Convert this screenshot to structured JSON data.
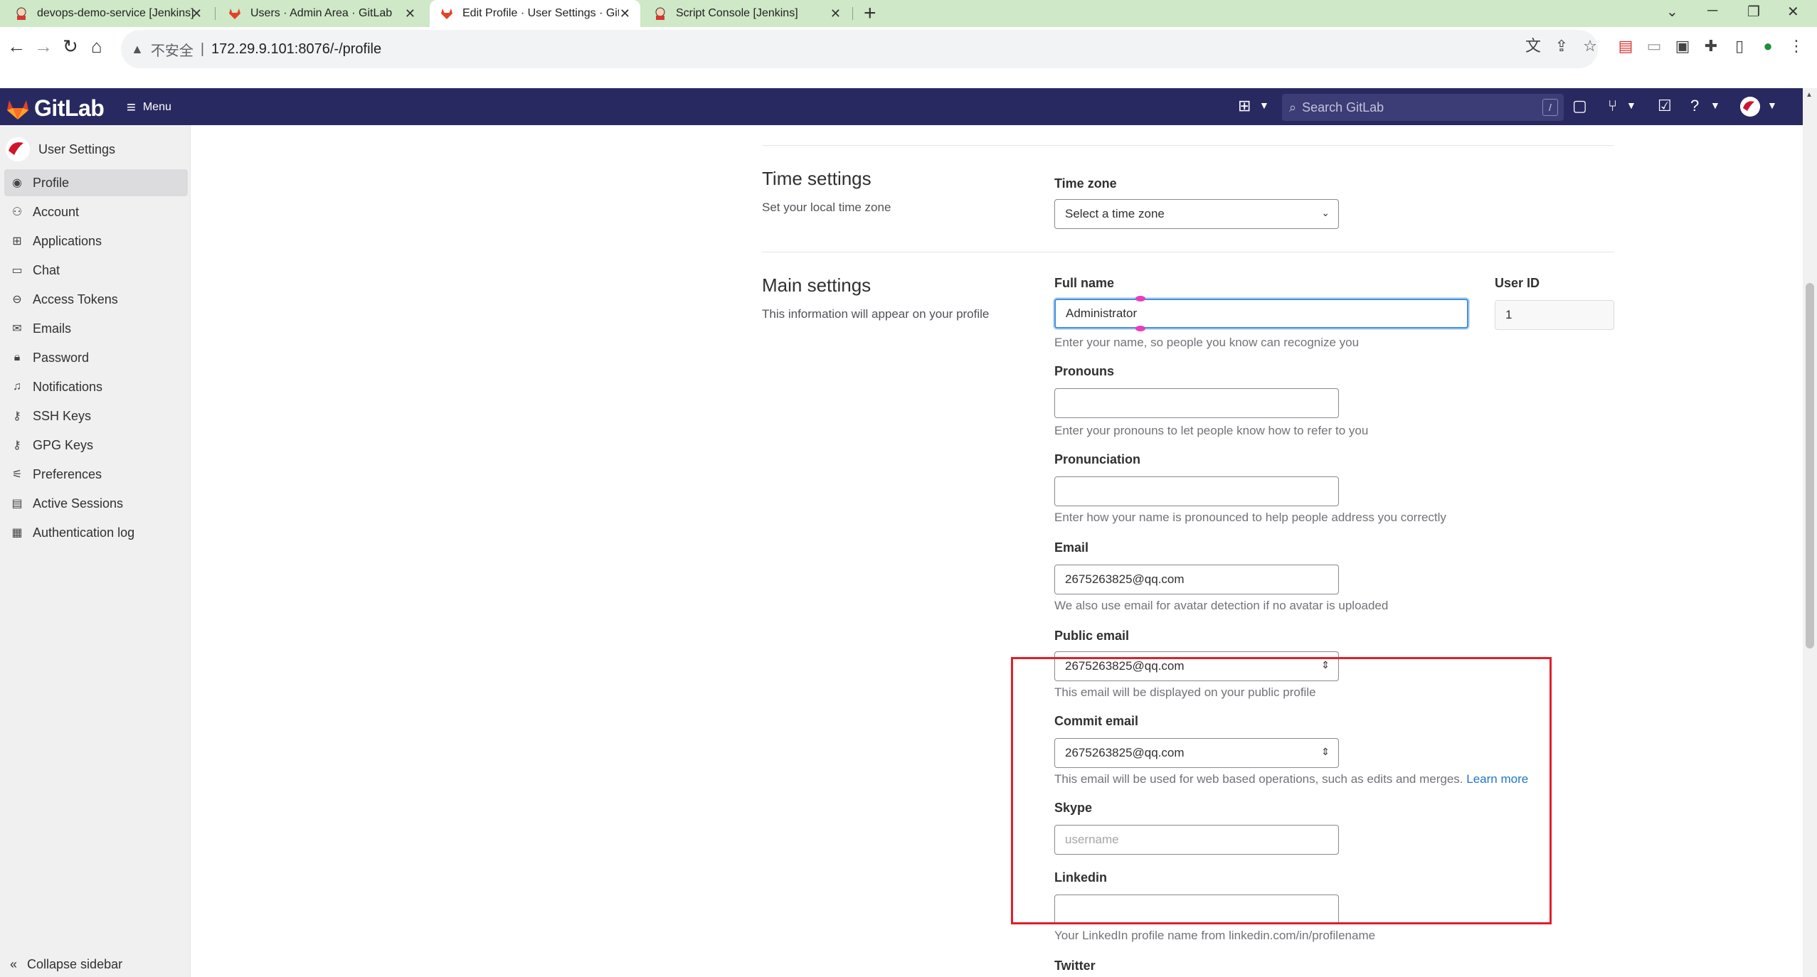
{
  "browser": {
    "tabs": [
      {
        "title": "devops-demo-service [Jenkins]"
      },
      {
        "title": "Users · Admin Area · GitLab"
      },
      {
        "title": "Edit Profile · User Settings · GitLab"
      },
      {
        "title": "Script Console [Jenkins]"
      }
    ],
    "address": {
      "insecure_label": "不安全",
      "separator": "|",
      "url": "172.29.9.101:8076/-/profile"
    }
  },
  "header": {
    "logo_text": "GitLab",
    "menu_label": "Menu",
    "search_placeholder": "Search GitLab",
    "search_shortcut": "/"
  },
  "sidebar": {
    "title": "User Settings",
    "items": [
      {
        "label": "Profile",
        "icon": "user-icon"
      },
      {
        "label": "Account",
        "icon": "account-icon"
      },
      {
        "label": "Applications",
        "icon": "applications-icon"
      },
      {
        "label": "Chat",
        "icon": "chat-icon"
      },
      {
        "label": "Access Tokens",
        "icon": "token-icon"
      },
      {
        "label": "Emails",
        "icon": "mail-icon"
      },
      {
        "label": "Password",
        "icon": "lock-icon"
      },
      {
        "label": "Notifications",
        "icon": "bell-icon"
      },
      {
        "label": "SSH Keys",
        "icon": "key-icon"
      },
      {
        "label": "GPG Keys",
        "icon": "key-icon"
      },
      {
        "label": "Preferences",
        "icon": "preferences-icon"
      },
      {
        "label": "Active Sessions",
        "icon": "monitor-icon"
      },
      {
        "label": "Authentication log",
        "icon": "log-icon"
      }
    ],
    "collapse_label": "Collapse sidebar"
  },
  "time_settings": {
    "title": "Time settings",
    "description": "Set your local time zone",
    "timezone_label": "Time zone",
    "timezone_value": "Select a time zone"
  },
  "main_settings": {
    "title": "Main settings",
    "description": "This information will appear on your profile",
    "full_name": {
      "label": "Full name",
      "value": "Administrator",
      "help": "Enter your name, so people you know can recognize you"
    },
    "user_id": {
      "label": "User ID",
      "value": "1"
    },
    "pronouns": {
      "label": "Pronouns",
      "value": "",
      "help": "Enter your pronouns to let people know how to refer to you"
    },
    "pronunciation": {
      "label": "Pronunciation",
      "value": "",
      "help": "Enter how your name is pronounced to help people address you correctly"
    },
    "email": {
      "label": "Email",
      "value": "2675263825@qq.com",
      "help": "We also use email for avatar detection if no avatar is uploaded"
    },
    "public_email": {
      "label": "Public email",
      "value": "2675263825@qq.com",
      "help": "This email will be displayed on your public profile"
    },
    "commit_email": {
      "label": "Commit email",
      "value": "2675263825@qq.com",
      "help": "This email will be used for web based operations, such as edits and merges.",
      "link": "Learn more"
    },
    "skype": {
      "label": "Skype",
      "placeholder": "username"
    },
    "linkedin": {
      "label": "Linkedin",
      "value": "",
      "help": "Your LinkedIn profile name from linkedin.com/in/profilename"
    },
    "twitter": {
      "label": "Twitter"
    }
  },
  "colors": {
    "header_bg": "#292961",
    "highlight_box": "#e0202a",
    "link": "#1f75cb",
    "focus_ring": "#428fdc"
  }
}
